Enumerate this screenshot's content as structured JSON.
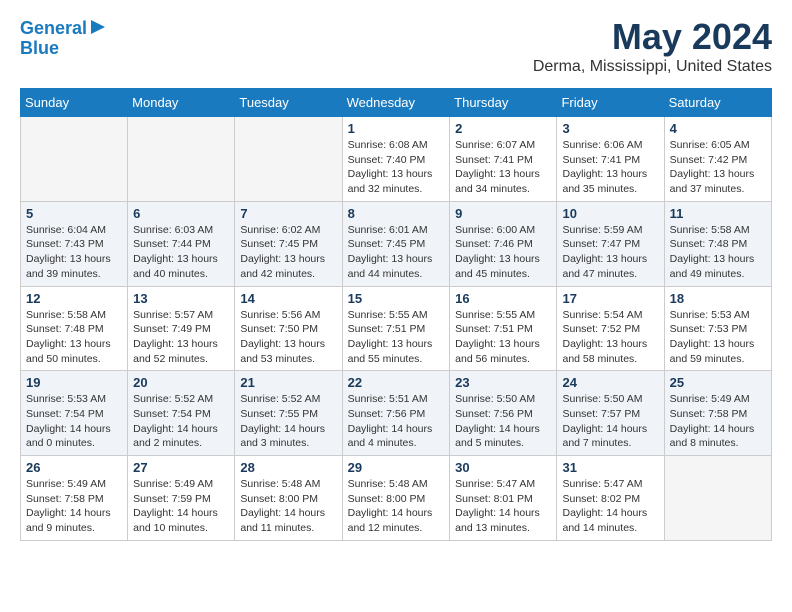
{
  "header": {
    "logo_line1": "General",
    "logo_line2": "Blue",
    "month": "May 2024",
    "location": "Derma, Mississippi, United States"
  },
  "days_of_week": [
    "Sunday",
    "Monday",
    "Tuesday",
    "Wednesday",
    "Thursday",
    "Friday",
    "Saturday"
  ],
  "weeks": [
    [
      {
        "num": "",
        "info": ""
      },
      {
        "num": "",
        "info": ""
      },
      {
        "num": "",
        "info": ""
      },
      {
        "num": "1",
        "info": "Sunrise: 6:08 AM\nSunset: 7:40 PM\nDaylight: 13 hours\nand 32 minutes."
      },
      {
        "num": "2",
        "info": "Sunrise: 6:07 AM\nSunset: 7:41 PM\nDaylight: 13 hours\nand 34 minutes."
      },
      {
        "num": "3",
        "info": "Sunrise: 6:06 AM\nSunset: 7:41 PM\nDaylight: 13 hours\nand 35 minutes."
      },
      {
        "num": "4",
        "info": "Sunrise: 6:05 AM\nSunset: 7:42 PM\nDaylight: 13 hours\nand 37 minutes."
      }
    ],
    [
      {
        "num": "5",
        "info": "Sunrise: 6:04 AM\nSunset: 7:43 PM\nDaylight: 13 hours\nand 39 minutes."
      },
      {
        "num": "6",
        "info": "Sunrise: 6:03 AM\nSunset: 7:44 PM\nDaylight: 13 hours\nand 40 minutes."
      },
      {
        "num": "7",
        "info": "Sunrise: 6:02 AM\nSunset: 7:45 PM\nDaylight: 13 hours\nand 42 minutes."
      },
      {
        "num": "8",
        "info": "Sunrise: 6:01 AM\nSunset: 7:45 PM\nDaylight: 13 hours\nand 44 minutes."
      },
      {
        "num": "9",
        "info": "Sunrise: 6:00 AM\nSunset: 7:46 PM\nDaylight: 13 hours\nand 45 minutes."
      },
      {
        "num": "10",
        "info": "Sunrise: 5:59 AM\nSunset: 7:47 PM\nDaylight: 13 hours\nand 47 minutes."
      },
      {
        "num": "11",
        "info": "Sunrise: 5:58 AM\nSunset: 7:48 PM\nDaylight: 13 hours\nand 49 minutes."
      }
    ],
    [
      {
        "num": "12",
        "info": "Sunrise: 5:58 AM\nSunset: 7:48 PM\nDaylight: 13 hours\nand 50 minutes."
      },
      {
        "num": "13",
        "info": "Sunrise: 5:57 AM\nSunset: 7:49 PM\nDaylight: 13 hours\nand 52 minutes."
      },
      {
        "num": "14",
        "info": "Sunrise: 5:56 AM\nSunset: 7:50 PM\nDaylight: 13 hours\nand 53 minutes."
      },
      {
        "num": "15",
        "info": "Sunrise: 5:55 AM\nSunset: 7:51 PM\nDaylight: 13 hours\nand 55 minutes."
      },
      {
        "num": "16",
        "info": "Sunrise: 5:55 AM\nSunset: 7:51 PM\nDaylight: 13 hours\nand 56 minutes."
      },
      {
        "num": "17",
        "info": "Sunrise: 5:54 AM\nSunset: 7:52 PM\nDaylight: 13 hours\nand 58 minutes."
      },
      {
        "num": "18",
        "info": "Sunrise: 5:53 AM\nSunset: 7:53 PM\nDaylight: 13 hours\nand 59 minutes."
      }
    ],
    [
      {
        "num": "19",
        "info": "Sunrise: 5:53 AM\nSunset: 7:54 PM\nDaylight: 14 hours\nand 0 minutes."
      },
      {
        "num": "20",
        "info": "Sunrise: 5:52 AM\nSunset: 7:54 PM\nDaylight: 14 hours\nand 2 minutes."
      },
      {
        "num": "21",
        "info": "Sunrise: 5:52 AM\nSunset: 7:55 PM\nDaylight: 14 hours\nand 3 minutes."
      },
      {
        "num": "22",
        "info": "Sunrise: 5:51 AM\nSunset: 7:56 PM\nDaylight: 14 hours\nand 4 minutes."
      },
      {
        "num": "23",
        "info": "Sunrise: 5:50 AM\nSunset: 7:56 PM\nDaylight: 14 hours\nand 5 minutes."
      },
      {
        "num": "24",
        "info": "Sunrise: 5:50 AM\nSunset: 7:57 PM\nDaylight: 14 hours\nand 7 minutes."
      },
      {
        "num": "25",
        "info": "Sunrise: 5:49 AM\nSunset: 7:58 PM\nDaylight: 14 hours\nand 8 minutes."
      }
    ],
    [
      {
        "num": "26",
        "info": "Sunrise: 5:49 AM\nSunset: 7:58 PM\nDaylight: 14 hours\nand 9 minutes."
      },
      {
        "num": "27",
        "info": "Sunrise: 5:49 AM\nSunset: 7:59 PM\nDaylight: 14 hours\nand 10 minutes."
      },
      {
        "num": "28",
        "info": "Sunrise: 5:48 AM\nSunset: 8:00 PM\nDaylight: 14 hours\nand 11 minutes."
      },
      {
        "num": "29",
        "info": "Sunrise: 5:48 AM\nSunset: 8:00 PM\nDaylight: 14 hours\nand 12 minutes."
      },
      {
        "num": "30",
        "info": "Sunrise: 5:47 AM\nSunset: 8:01 PM\nDaylight: 14 hours\nand 13 minutes."
      },
      {
        "num": "31",
        "info": "Sunrise: 5:47 AM\nSunset: 8:02 PM\nDaylight: 14 hours\nand 14 minutes."
      },
      {
        "num": "",
        "info": ""
      }
    ]
  ]
}
